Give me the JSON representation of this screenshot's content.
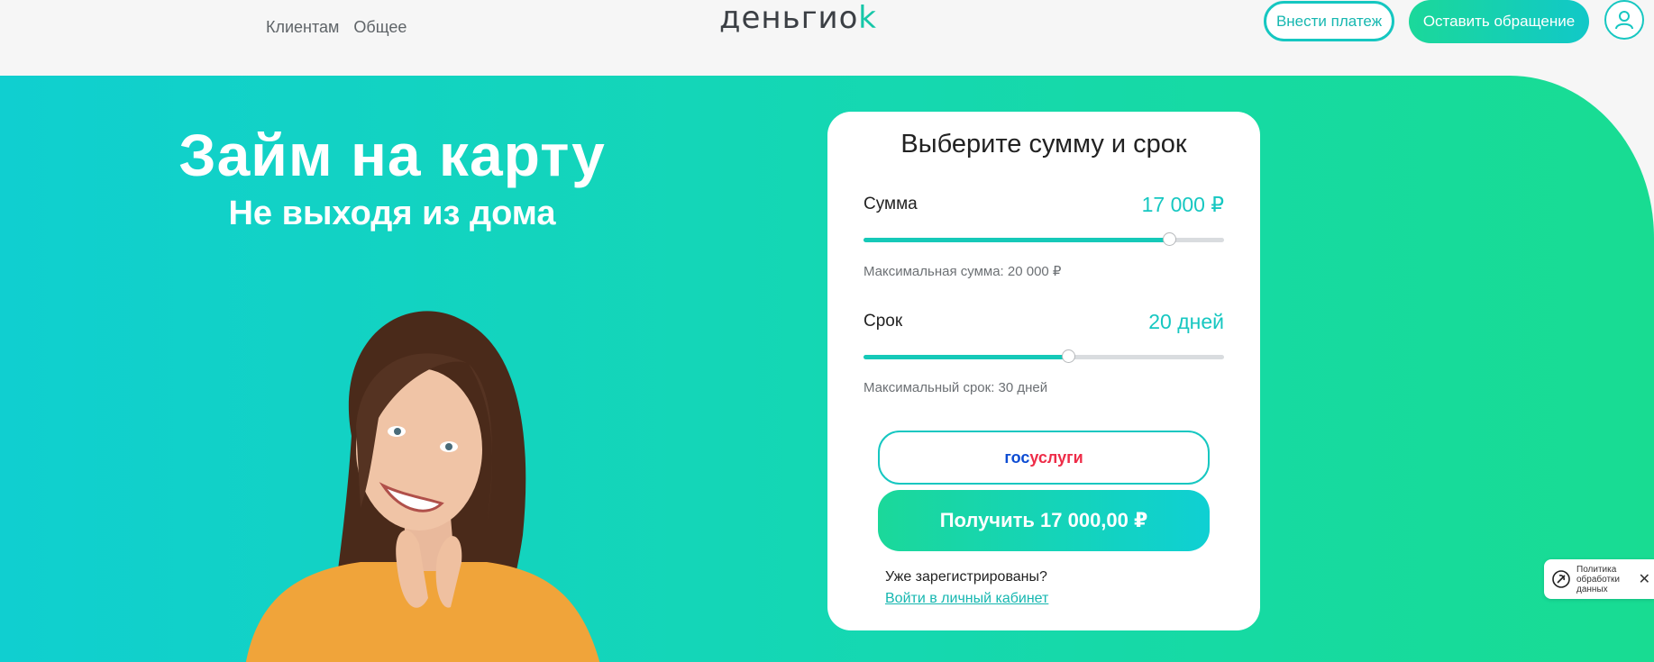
{
  "header": {
    "nav": [
      "Клиентам",
      "Общее"
    ],
    "logo_text": "деньгиo",
    "logo_accent": "k",
    "pay_button": "Внести платеж",
    "appeal_button": "Оставить обращение"
  },
  "hero": {
    "title": "Займ на карту",
    "subtitle": "Не выходя из дома"
  },
  "calculator": {
    "title": "Выберите сумму и срок",
    "amount_label": "Сумма",
    "amount_value": "17 000 ₽",
    "amount_slider_fraction": 0.85,
    "amount_hint": "Максимальная сумма: 20 000 ₽",
    "term_label": "Срок",
    "term_value": "20 дней",
    "term_slider_fraction": 0.57,
    "term_hint": "Максимальный срок: 30 дней",
    "gos_part1": "гос",
    "gos_part2": "услуги",
    "get_button": "Получить 17 000,00 ₽",
    "registered_text": "Уже зарегистрированы?",
    "login_link": "Войти в личный кабинет"
  },
  "privacy": {
    "text": "Политика обработки данных",
    "close": "✕"
  },
  "colors": {
    "accent": "#16c7c1",
    "green": "#1bd89a",
    "gos_blue": "#0d4cd3",
    "gos_red": "#ee2c48"
  }
}
